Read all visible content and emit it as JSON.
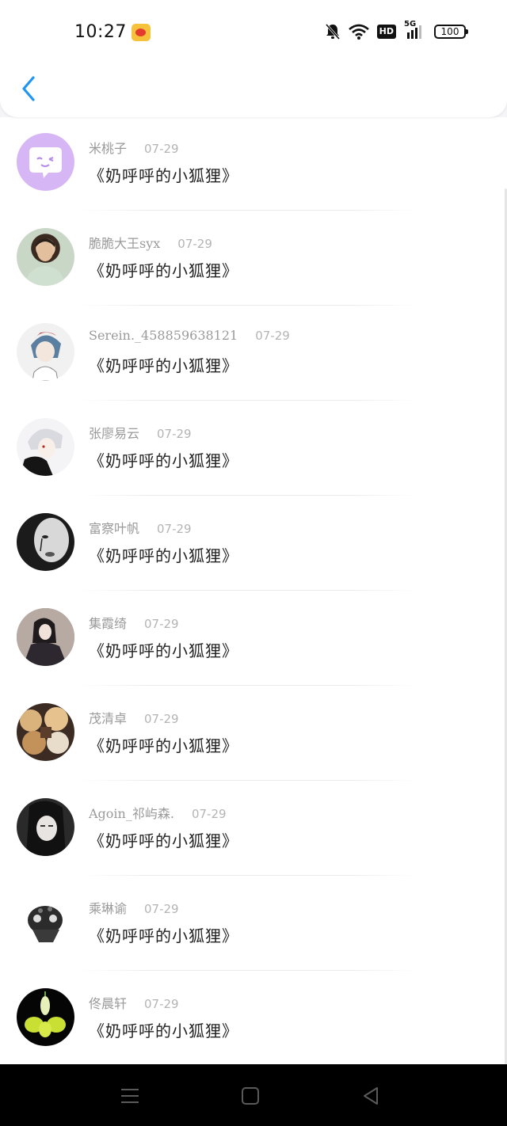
{
  "status_bar": {
    "time": "10:27",
    "network_badge": "HD",
    "signal_label": "5G",
    "battery_level": "100"
  },
  "header": {
    "back_icon": "chevron-left-icon",
    "accent_color": "#2196f3"
  },
  "messages": [
    {
      "name": "米桃子",
      "date": "07-29",
      "text": "《奶呼呼的小狐狸》",
      "avatar": "purple-chat-bubble"
    },
    {
      "name": "脆脆大王syx",
      "date": "07-29",
      "text": "《奶呼呼的小狐狸》",
      "avatar": "photo"
    },
    {
      "name": "Serein._458859638121",
      "date": "07-29",
      "text": "《奶呼呼的小狐狸》",
      "avatar": "photo"
    },
    {
      "name": "张廖易云",
      "date": "07-29",
      "text": "《奶呼呼的小狐狸》",
      "avatar": "photo"
    },
    {
      "name": "富察叶帆",
      "date": "07-29",
      "text": "《奶呼呼的小狐狸》",
      "avatar": "photo"
    },
    {
      "name": "集霞绮",
      "date": "07-29",
      "text": "《奶呼呼的小狐狸》",
      "avatar": "photo"
    },
    {
      "name": "茂清卓",
      "date": "07-29",
      "text": "《奶呼呼的小狐狸》",
      "avatar": "photo"
    },
    {
      "name": "Agoin_祁屿森.",
      "date": "07-29",
      "text": "《奶呼呼的小狐狸》",
      "avatar": "photo"
    },
    {
      "name": "乘琳谕",
      "date": "07-29",
      "text": "《奶呼呼的小狐狸》",
      "avatar": "photo"
    },
    {
      "name": "佟晨轩",
      "date": "07-29",
      "text": "《奶呼呼的小狐狸》",
      "avatar": "photo"
    }
  ],
  "nav_bar": {
    "buttons": [
      "menu-icon",
      "home-square-icon",
      "back-triangle-icon"
    ]
  }
}
